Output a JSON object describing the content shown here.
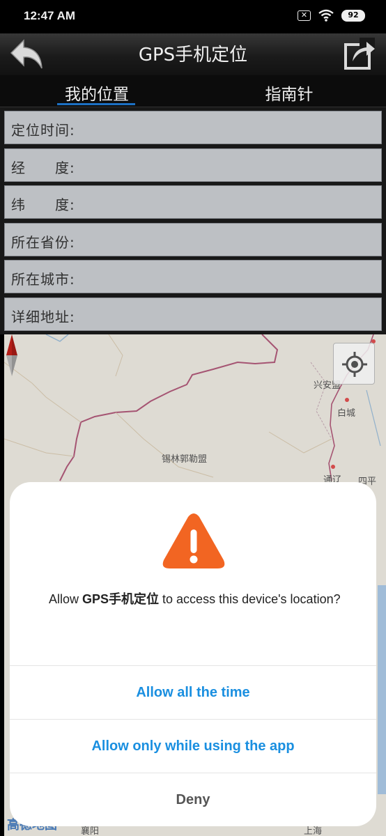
{
  "status_bar": {
    "time": "12:47 AM",
    "battery": "92",
    "sim_icon": "sim-x-icon",
    "wifi_icon": "wifi-icon"
  },
  "app_bar": {
    "title": "GPS手机定位",
    "back_icon": "back-arrow-icon",
    "share_icon": "share-icon"
  },
  "tabs": [
    {
      "label": "我的位置",
      "active": true
    },
    {
      "label": "指南针",
      "active": false
    }
  ],
  "info_rows": [
    {
      "label": "定位时间:"
    },
    {
      "label": "经　　度:"
    },
    {
      "label": "纬　　度:"
    },
    {
      "label": "所在省份:"
    },
    {
      "label": "所在城市:"
    },
    {
      "label": "详细地址:"
    }
  ],
  "map": {
    "labels": [
      "锡林郭勒盟",
      "兴安盟",
      "白城",
      "通辽",
      "四平",
      "上海",
      "襄阳"
    ],
    "logo": "高德地图"
  },
  "dialog": {
    "prompt_prefix": "Allow ",
    "app_name": "GPS手机定位",
    "prompt_suffix": " to access this device's location?",
    "options": {
      "allow_all": "Allow all the time",
      "allow_while_using": "Allow only while using the app",
      "deny": "Deny"
    },
    "accent_color": "#1a8fe0",
    "icon_color": "#f26522"
  }
}
